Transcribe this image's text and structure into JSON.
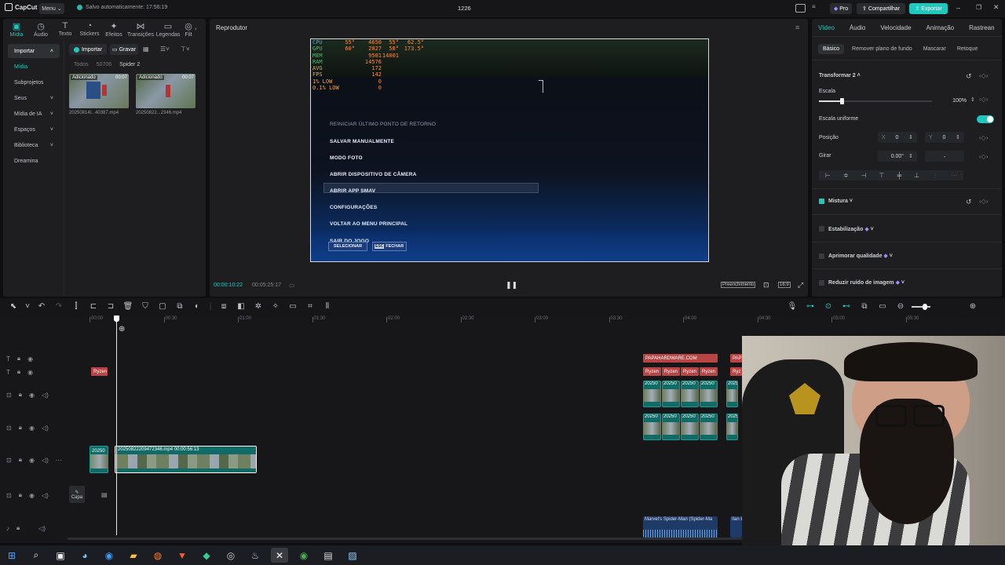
{
  "app": {
    "logo": "CapCut",
    "menu": "Menu",
    "autosave": "Salvo automaticamente: 17:56:19",
    "project_title": "1226",
    "pro": "Pro",
    "share": "Compartilhar",
    "export": "Exportar"
  },
  "tool_tabs": [
    {
      "label": "Mídia",
      "icon": "media-icon"
    },
    {
      "label": "Áudio",
      "icon": "audio-icon"
    },
    {
      "label": "Texto",
      "icon": "text-icon"
    },
    {
      "label": "Stickers",
      "icon": "sticker-icon"
    },
    {
      "label": "Efeitos",
      "icon": "effects-icon"
    },
    {
      "label": "Transições",
      "icon": "transition-icon"
    },
    {
      "label": "Legendas",
      "icon": "captions-icon"
    },
    {
      "label": "Filt",
      "icon": "filter-icon"
    }
  ],
  "sidebar": {
    "items": [
      {
        "label": "Importar"
      },
      {
        "label": "Mídia"
      },
      {
        "label": "Subprojetos"
      },
      {
        "label": "Seus"
      },
      {
        "label": "Mídia de IA"
      },
      {
        "label": "Espaços"
      },
      {
        "label": "Biblioteca"
      },
      {
        "label": "Dreamina"
      }
    ]
  },
  "media": {
    "import_btn": "Importar",
    "record_btn": "Gravar",
    "breadcrumb": [
      "Todos",
      "50706",
      "Spider 2"
    ],
    "items": [
      {
        "badge": "Adicionado",
        "duration": "00:07",
        "filename": "20250814l...40387.mp4"
      },
      {
        "badge": "Adicionado",
        "duration": "00:07",
        "filename": "20250822...2346.mp4"
      }
    ]
  },
  "player": {
    "title": "Reprodutor",
    "current_time": "00:00:10:22",
    "total_time": "00:05:25:17",
    "fill_btn": "Preenchimento",
    "ratio": "16:9",
    "overlay_stats": [
      {
        "label": "CPU",
        "v1": "55°",
        "v2": "4650",
        "v3": "55°",
        "v4": "62.5°"
      },
      {
        "label": "GPU",
        "v1": "60°",
        "v2": "2827",
        "v3": "58°",
        "v4": "173.5°"
      },
      {
        "label": "MEM",
        "v1": "",
        "v2": "9501",
        "v3": "14001",
        "v4": ""
      },
      {
        "label": "RAM",
        "v1": "",
        "v2": "14576",
        "v3": "",
        "v4": ""
      },
      {
        "label": "AVG",
        "v1": "",
        "v2": "172",
        "v3": "",
        "v4": ""
      },
      {
        "label": "FPS",
        "v1": "",
        "v2": "142",
        "v3": "",
        "v4": ""
      },
      {
        "label": "1% LOW",
        "v1": "",
        "v2": "0",
        "v3": "",
        "v4": ""
      },
      {
        "label": "0.1% LOW",
        "v1": "",
        "v2": "0",
        "v3": "",
        "v4": ""
      }
    ],
    "game_menu": [
      "REINICIAR ÚLTIMO PONTO DE RETORNO",
      "SALVAR MANUALMENTE",
      "MODO FOTO",
      "ABRIR DISPOSITIVO DE CÂMERA",
      "ABRIR APP SMAV",
      "CONFIGURAÇÕES",
      "VOLTAR AO MENU PRINCIPAL",
      "SAIR DO JOGO"
    ],
    "game_buttons": [
      {
        "key": "",
        "label": "SELECIONAR"
      },
      {
        "key": "ESC",
        "label": "FECHAR"
      }
    ]
  },
  "properties": {
    "tabs": [
      "Vídeo",
      "Áudio",
      "Velocidade",
      "Animação",
      "Rastream"
    ],
    "subtabs": [
      "Básico",
      "Remover plano de fundo",
      "Mascarar",
      "Retoque"
    ],
    "section": "Transformar 2",
    "scale_label": "Escala",
    "scale_value": "100%",
    "scale_level": 0.2,
    "uniform_label": "Escala uniforme",
    "position_label": "Posição",
    "pos_x_label": "X",
    "pos_x": "0",
    "pos_y_label": "Y",
    "pos_y": "0",
    "rotate_label": "Girar",
    "rotate_value": "0.00°",
    "mix_label": "Mistura",
    "stabilize_label": "Estabilização",
    "quality_label": "Aprimorar qualidade",
    "noise_label": "Reduzir ruído de imagem"
  },
  "timeline": {
    "ruler": [
      "00:00",
      "00:30",
      "01:00",
      "01:30",
      "02:00",
      "02:30",
      "03:00",
      "03:30",
      "04:00",
      "04:30",
      "05:00",
      "05:30"
    ],
    "cover_label": "Capa",
    "text_clip_small": "Ryzen",
    "main_clip_label": "20250822209472346.mp4  00:00:56:13",
    "main_clip_left": "20250",
    "top_text_clip": "PAPAHARDWARE.COM",
    "top_text_clip2": "PAP",
    "ryzen_clips": [
      "Ryzen",
      "Ryzen",
      "Ryzen",
      "Ryzen"
    ],
    "ryzen_clip2": "Ryz",
    "video_clip_labels": [
      "20250",
      "20250",
      "20250",
      "20250",
      "2025"
    ],
    "audio_clip1": "Marvel's Spider-Man (Spider-Ma",
    "audio_clip2": "Ilan E"
  },
  "taskbar": {
    "icons": [
      "windows-start-icon",
      "search-icon",
      "task-view-icon",
      "copilot-icon",
      "edge-icon",
      "file-explorer-icon",
      "firefox-icon",
      "brave-icon",
      "app-icon",
      "obs-icon",
      "steam-icon",
      "capcut-icon",
      "chrome-icon",
      "app2-icon",
      "app3-icon"
    ]
  }
}
